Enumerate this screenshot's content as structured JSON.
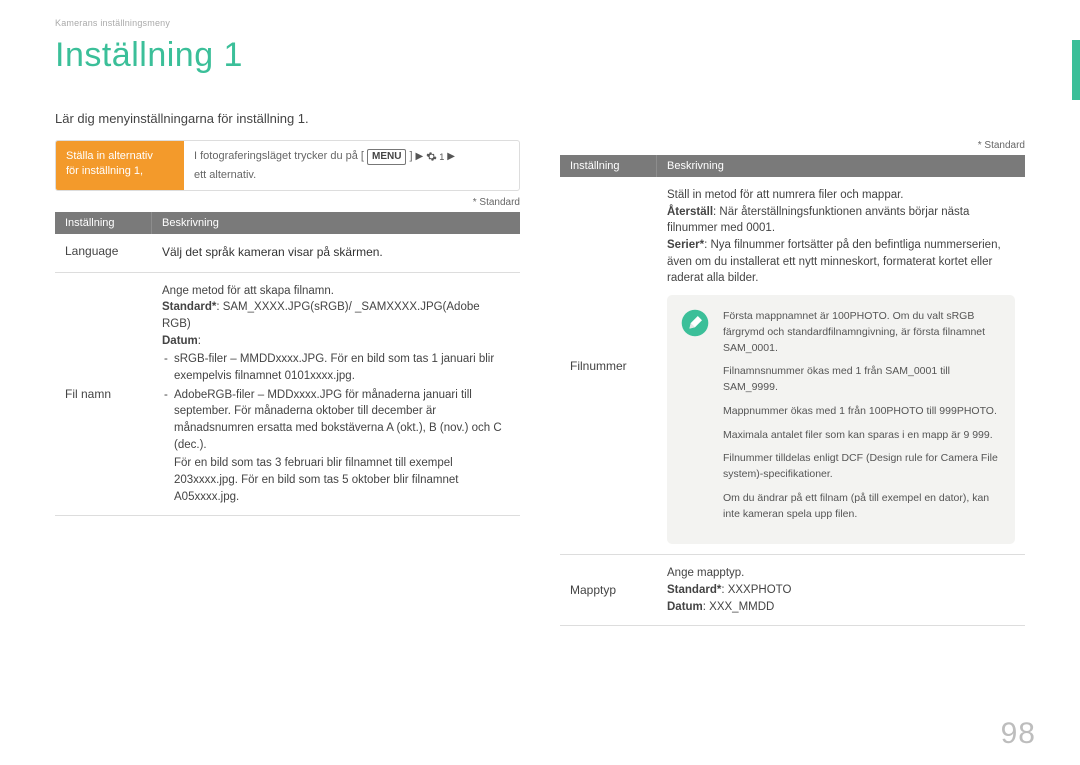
{
  "breadcrumb": "Kamerans inställningsmeny",
  "page_title": "Inställning 1",
  "intro": "Lär dig menyinställningarna för inställning 1.",
  "callout": {
    "left_line1": "Ställa in alternativ",
    "left_line2": "för inställning 1,",
    "right_prefix": "I fotograferingsläget trycker du på [",
    "menu_chip": "MENU",
    "right_mid": "] ",
    "gear_num": "1",
    "right_suffix": "ett alternativ."
  },
  "footnote": "* Standard",
  "th_setting": "Inställning",
  "th_desc": "Beskrivning",
  "left_table": {
    "row1": {
      "label": "Language",
      "desc": "Välj det språk kameran visar på skärmen."
    },
    "row2": {
      "label": "Fil namn",
      "line1": "Ange metod för att skapa filnamn.",
      "std_label": "Standard*",
      "std_text": ": SAM_XXXX.JPG(sRGB)/ _SAMXXXX.JPG(Adobe RGB)",
      "datum_label": "Datum",
      "datum_colon": ":",
      "d1": "sRGB-filer – MMDDxxxx.JPG. För en bild som tas 1 januari blir exempelvis filnamnet 0101xxxx.jpg.",
      "d2": "AdobeRGB-filer – MDDxxxx.JPG för månaderna januari till september. För månaderna oktober till december är månadsnumren ersatta med bokstäverna A (okt.), B (nov.) och C (dec.).",
      "d_after": "För en bild som tas 3 februari blir filnamnet till exempel 203xxxx.jpg. För en bild som tas 5 oktober blir filnamnet A05xxxx.jpg."
    }
  },
  "right_table": {
    "row1": {
      "label": "Filnummer",
      "line1": "Ställ in metod för att numrera filer och mappar.",
      "reset_label": "Återställ",
      "reset_text": ": När återställningsfunktionen använts börjar nästa filnummer med 0001.",
      "series_label": "Serier*",
      "series_text": ": Nya filnummer fortsätter på den befintliga nummerserien, även om du installerat ett nytt minneskort, formaterat kortet eller raderat alla bilder.",
      "note1": "Första mappnamnet är 100PHOTO. Om du valt sRGB färgrymd och standardfilnamngivning, är första filnamnet SAM_0001.",
      "note2": "Filnamnsnummer ökas med 1 från SAM_0001 till SAM_9999.",
      "note3": "Mappnummer ökas med 1 från 100PHOTO till 999PHOTO.",
      "note4": "Maximala antalet filer som kan sparas i en mapp är 9 999.",
      "note5": "Filnummer tilldelas enligt DCF (Design rule for Camera File system)-specifikationer.",
      "note6": "Om du ändrar på ett filnam (på till exempel en dator), kan inte kameran spela upp filen."
    },
    "row2": {
      "label": "Mapptyp",
      "line1": "Ange mapptyp.",
      "std_label": "Standard*",
      "std_text": ": XXXPHOTO",
      "datum_label": "Datum",
      "datum_text": ": XXX_MMDD"
    }
  },
  "page_number": "98"
}
